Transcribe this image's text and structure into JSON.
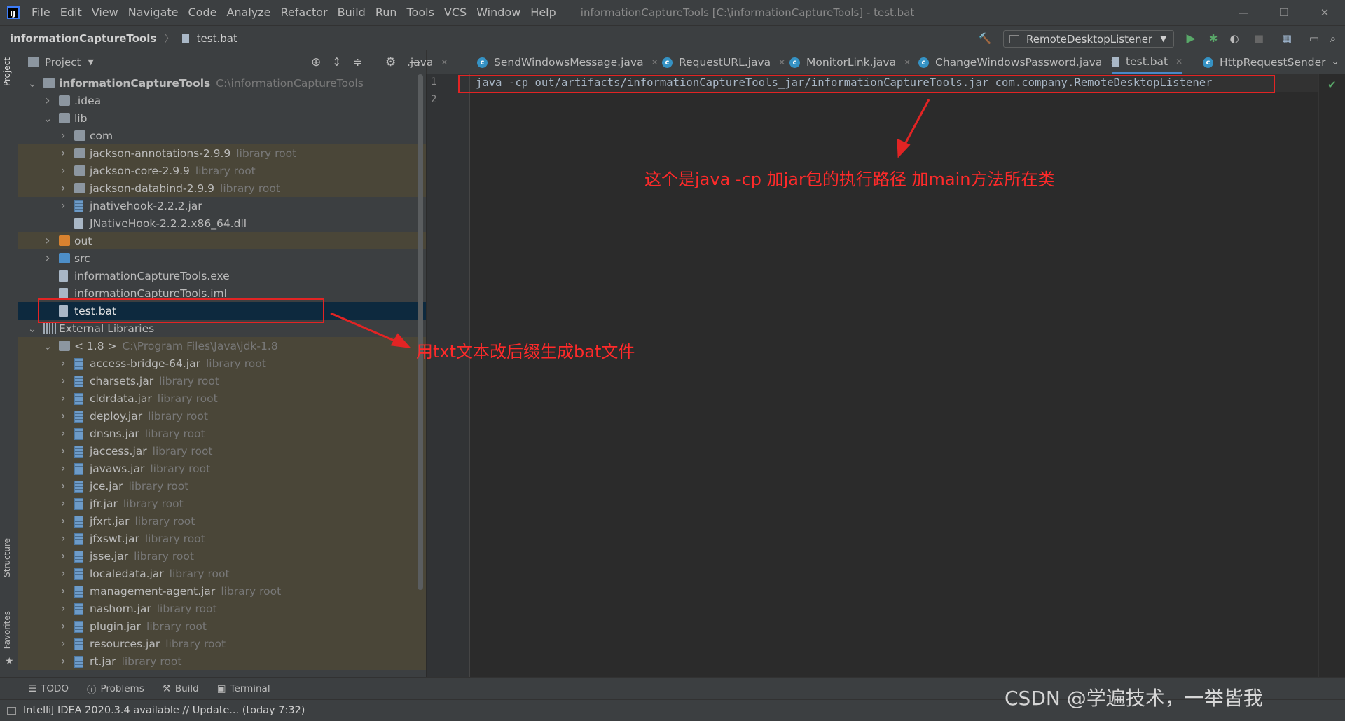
{
  "titlebar": {
    "menus": [
      "File",
      "Edit",
      "View",
      "Navigate",
      "Code",
      "Analyze",
      "Refactor",
      "Build",
      "Run",
      "Tools",
      "VCS",
      "Window",
      "Help"
    ],
    "title": "informationCaptureTools [C:\\informationCaptureTools] - test.bat"
  },
  "navbar": {
    "project": "informationCaptureTools",
    "file": "test.bat",
    "run_config": "RemoteDesktopListener"
  },
  "project_panel": {
    "title": "Project",
    "tree": [
      {
        "name": "informationCaptureTools",
        "hint": "C:\\informationCaptureTools",
        "depth": 0,
        "type": "folder",
        "expanded": true,
        "bold": true
      },
      {
        "name": ".idea",
        "depth": 1,
        "type": "folder",
        "collapsed": true
      },
      {
        "name": "lib",
        "depth": 1,
        "type": "folder",
        "expanded": true
      },
      {
        "name": "com",
        "depth": 2,
        "type": "folder",
        "collapsed": true
      },
      {
        "name": "jackson-annotations-2.9.9",
        "hint": "library root",
        "depth": 2,
        "type": "folder",
        "collapsed": true,
        "lib": true
      },
      {
        "name": "jackson-core-2.9.9",
        "hint": "library root",
        "depth": 2,
        "type": "folder",
        "collapsed": true,
        "lib": true
      },
      {
        "name": "jackson-databind-2.9.9",
        "hint": "library root",
        "depth": 2,
        "type": "folder",
        "collapsed": true,
        "lib": true
      },
      {
        "name": "jnativehook-2.2.2.jar",
        "depth": 2,
        "type": "jar",
        "collapsed": true
      },
      {
        "name": "JNativeHook-2.2.2.x86_64.dll",
        "depth": 2,
        "type": "file"
      },
      {
        "name": "out",
        "depth": 1,
        "type": "folder-orange",
        "collapsed": true,
        "lib": true
      },
      {
        "name": "src",
        "depth": 1,
        "type": "folder-blue",
        "collapsed": true
      },
      {
        "name": "informationCaptureTools.exe",
        "depth": 1,
        "type": "file"
      },
      {
        "name": "informationCaptureTools.iml",
        "depth": 1,
        "type": "file"
      },
      {
        "name": "test.bat",
        "depth": 1,
        "type": "file",
        "selected": true
      },
      {
        "name": "External Libraries",
        "depth": 0,
        "type": "libs",
        "expanded": true
      },
      {
        "name": "< 1.8 >",
        "hint": "C:\\Program Files\\Java\\jdk-1.8",
        "depth": 1,
        "type": "folder",
        "expanded": true,
        "lib": true
      },
      {
        "name": "access-bridge-64.jar",
        "hint": "library root",
        "depth": 2,
        "type": "jar",
        "collapsed": true,
        "lib": true
      },
      {
        "name": "charsets.jar",
        "hint": "library root",
        "depth": 2,
        "type": "jar",
        "collapsed": true,
        "lib": true
      },
      {
        "name": "cldrdata.jar",
        "hint": "library root",
        "depth": 2,
        "type": "jar",
        "collapsed": true,
        "lib": true
      },
      {
        "name": "deploy.jar",
        "hint": "library root",
        "depth": 2,
        "type": "jar",
        "collapsed": true,
        "lib": true
      },
      {
        "name": "dnsns.jar",
        "hint": "library root",
        "depth": 2,
        "type": "jar",
        "collapsed": true,
        "lib": true
      },
      {
        "name": "jaccess.jar",
        "hint": "library root",
        "depth": 2,
        "type": "jar",
        "collapsed": true,
        "lib": true
      },
      {
        "name": "javaws.jar",
        "hint": "library root",
        "depth": 2,
        "type": "jar",
        "collapsed": true,
        "lib": true
      },
      {
        "name": "jce.jar",
        "hint": "library root",
        "depth": 2,
        "type": "jar",
        "collapsed": true,
        "lib": true
      },
      {
        "name": "jfr.jar",
        "hint": "library root",
        "depth": 2,
        "type": "jar",
        "collapsed": true,
        "lib": true
      },
      {
        "name": "jfxrt.jar",
        "hint": "library root",
        "depth": 2,
        "type": "jar",
        "collapsed": true,
        "lib": true
      },
      {
        "name": "jfxswt.jar",
        "hint": "library root",
        "depth": 2,
        "type": "jar",
        "collapsed": true,
        "lib": true
      },
      {
        "name": "jsse.jar",
        "hint": "library root",
        "depth": 2,
        "type": "jar",
        "collapsed": true,
        "lib": true
      },
      {
        "name": "localedata.jar",
        "hint": "library root",
        "depth": 2,
        "type": "jar",
        "collapsed": true,
        "lib": true
      },
      {
        "name": "management-agent.jar",
        "hint": "library root",
        "depth": 2,
        "type": "jar",
        "collapsed": true,
        "lib": true
      },
      {
        "name": "nashorn.jar",
        "hint": "library root",
        "depth": 2,
        "type": "jar",
        "collapsed": true,
        "lib": true
      },
      {
        "name": "plugin.jar",
        "hint": "library root",
        "depth": 2,
        "type": "jar",
        "collapsed": true,
        "lib": true
      },
      {
        "name": "resources.jar",
        "hint": "library root",
        "depth": 2,
        "type": "jar",
        "collapsed": true,
        "lib": true
      },
      {
        "name": "rt.jar",
        "hint": "library root",
        "depth": 2,
        "type": "jar",
        "collapsed": true,
        "lib": true
      }
    ]
  },
  "tabs": [
    {
      "label": ".java",
      "cls": false
    },
    {
      "label": "SendWindowsMessage.java",
      "cls": true
    },
    {
      "label": "RequestURL.java",
      "cls": true
    },
    {
      "label": "MonitorLink.java",
      "cls": true
    },
    {
      "label": "ChangeWindowsPassword.java",
      "cls": true
    },
    {
      "label": "test.bat",
      "cls": false,
      "active": true
    },
    {
      "label": "HttpRequestSender",
      "cls": true
    }
  ],
  "editor": {
    "line_numbers": [
      "1",
      "2"
    ],
    "lines": [
      "java -cp out/artifacts/informationCaptureTools_jar/informationCaptureTools.jar com.company.RemoteDesktopListener",
      ""
    ]
  },
  "left_strip": {
    "project": "Project",
    "structure": "Structure",
    "favorites": "Favorites"
  },
  "bottom_tools": [
    "TODO",
    "Problems",
    "Build",
    "Terminal"
  ],
  "status": {
    "text": "IntelliJ IDEA 2020.3.4 available // Update... (today 7:32)"
  },
  "annotations": {
    "bat_note": "用txt文本改后缀生成bat文件",
    "cmd_note": "这个是java -cp 加jar包的执行路径 加main方法所在类"
  },
  "watermark": "CSDN @学遍技术，一举皆我",
  "colors": {
    "annotation": "#e22424",
    "selection": "#0d293e",
    "library_bg": "#4a4638",
    "accent": "#4a88c7"
  }
}
